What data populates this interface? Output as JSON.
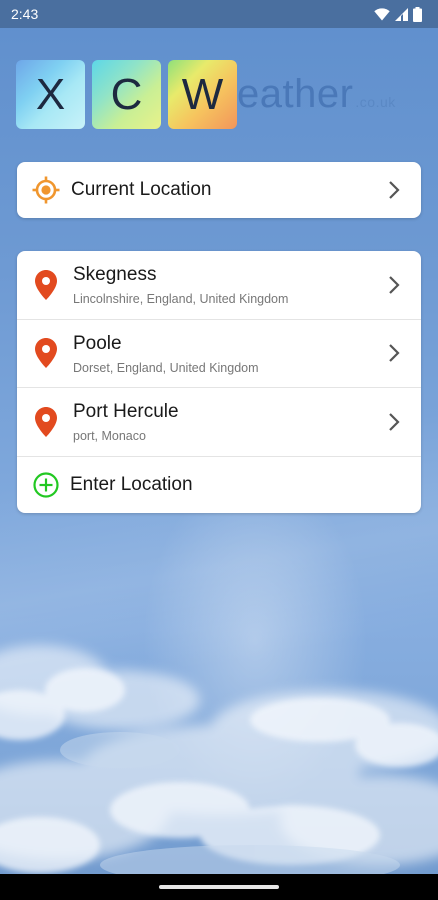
{
  "status_bar": {
    "time": "2:43",
    "icons": [
      "wifi-icon",
      "signal-icon",
      "battery-icon"
    ]
  },
  "logo": {
    "tiles": [
      "X",
      "C",
      "W"
    ],
    "rest": "eather",
    "extension": ".co.uk"
  },
  "current_location": {
    "label": "Current Location",
    "icon": "crosshair-icon",
    "accent": "#f0962e"
  },
  "locations": [
    {
      "name": "Skegness",
      "detail": "Lincolnshire, England, United Kingdom"
    },
    {
      "name": "Poole",
      "detail": "Dorset, England, United Kingdom"
    },
    {
      "name": "Port Hercule",
      "detail": "port, Monaco"
    }
  ],
  "enter_location": {
    "label": "Enter Location",
    "icon": "add-circle-icon",
    "accent": "#22c822"
  },
  "colors": {
    "pin": "#e24a1f",
    "chevron": "#555555"
  }
}
